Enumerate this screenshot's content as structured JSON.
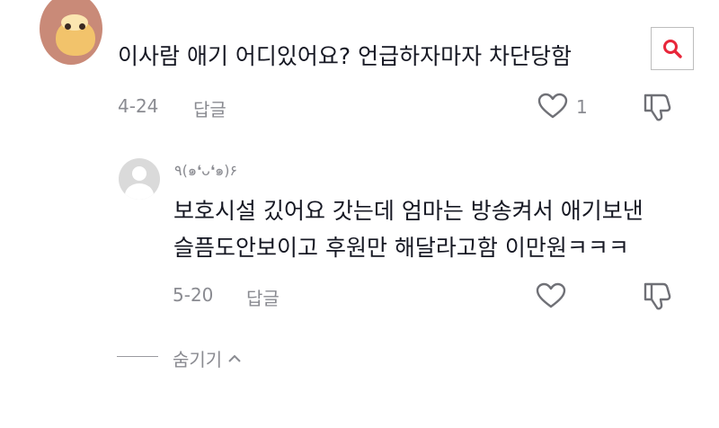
{
  "comment": {
    "text": "이사람 애기 어디있어요? 언급하자마자 차단당함",
    "date": "4-24",
    "reply_label": "답글",
    "like_count": "1"
  },
  "reply": {
    "username": "٩(๑❛ᴗ❛๑)۶",
    "text_line1": "보호시설 깄어요 갓는데 엄마는 방송켜서 애기보낸",
    "text_line2": "슬픔도안보이고 후원만 해달라고함 이만원ㅋㅋㅋ",
    "date": "5-20",
    "reply_label": "답글"
  },
  "hide_replies": {
    "label": "숨기기"
  },
  "icons": {
    "search": "search-icon",
    "like": "heart-outline-icon",
    "dislike": "thumbs-down-icon",
    "chevron": "chevron-up-icon"
  },
  "colors": {
    "search_accent": "#e8263a",
    "muted": "#8a8b91",
    "text": "#161823"
  }
}
